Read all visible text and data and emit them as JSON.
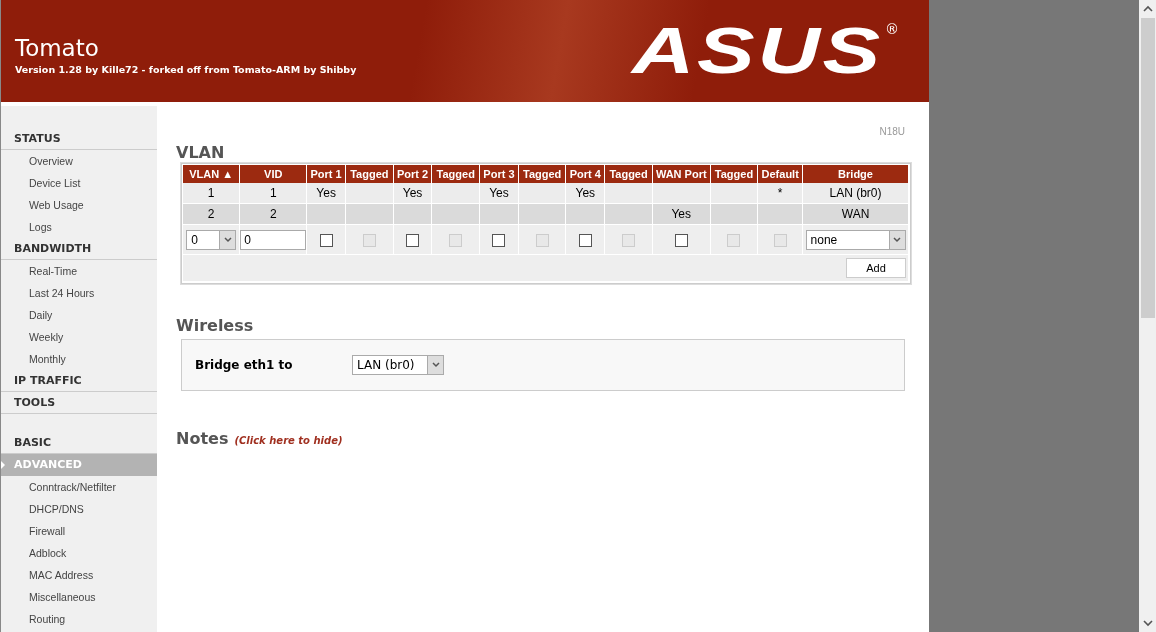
{
  "header": {
    "title": "Tomato",
    "subtitle": "Version 1.28 by Kille72 - forked off from Tomato-ARM by Shibby",
    "logo": "ASUS",
    "logo_mark": "®"
  },
  "sidebar": {
    "groups": [
      [
        {
          "label": "STATUS",
          "selected": false,
          "children": [
            {
              "label": "Overview"
            },
            {
              "label": "Device List"
            },
            {
              "label": "Web Usage"
            },
            {
              "label": "Logs"
            }
          ]
        },
        {
          "label": "BANDWIDTH",
          "selected": false,
          "children": [
            {
              "label": "Real-Time"
            },
            {
              "label": "Last 24 Hours"
            },
            {
              "label": "Daily"
            },
            {
              "label": "Weekly"
            },
            {
              "label": "Monthly"
            }
          ]
        },
        {
          "label": "IP TRAFFIC",
          "selected": false
        },
        {
          "label": "TOOLS",
          "selected": false
        }
      ],
      [
        {
          "label": "BASIC",
          "selected": false
        },
        {
          "label": "ADVANCED",
          "selected": true,
          "children": [
            {
              "label": "Conntrack/Netfilter"
            },
            {
              "label": "DHCP/DNS"
            },
            {
              "label": "Firewall"
            },
            {
              "label": "Adblock"
            },
            {
              "label": "MAC Address"
            },
            {
              "label": "Miscellaneous"
            },
            {
              "label": "Routing"
            }
          ]
        }
      ]
    ]
  },
  "model": "N18U",
  "vlan": {
    "title": "VLAN",
    "columns": [
      "VLAN ▲",
      "VID",
      "Port 1",
      "Tagged",
      "Port 2",
      "Tagged",
      "Port 3",
      "Tagged",
      "Port 4",
      "Tagged",
      "WAN Port",
      "Tagged",
      "Default",
      "Bridge"
    ],
    "rows": [
      [
        "1",
        "1",
        "Yes",
        "",
        "Yes",
        "",
        "Yes",
        "",
        "Yes",
        "",
        "",
        "",
        "*",
        "LAN (br0)"
      ],
      [
        "2",
        "2",
        "",
        "",
        "",
        "",
        "",
        "",
        "",
        "",
        "Yes",
        "",
        "",
        "WAN"
      ]
    ],
    "new_row": [
      {
        "kind": "select",
        "value": "0"
      },
      {
        "kind": "input",
        "value": "0"
      },
      {
        "kind": "checkbox",
        "checked": false,
        "disabled": false
      },
      {
        "kind": "checkbox",
        "checked": false,
        "disabled": true
      },
      {
        "kind": "checkbox",
        "checked": false,
        "disabled": false
      },
      {
        "kind": "checkbox",
        "checked": false,
        "disabled": true
      },
      {
        "kind": "checkbox",
        "checked": false,
        "disabled": false
      },
      {
        "kind": "checkbox",
        "checked": false,
        "disabled": true
      },
      {
        "kind": "checkbox",
        "checked": false,
        "disabled": false
      },
      {
        "kind": "checkbox",
        "checked": false,
        "disabled": true
      },
      {
        "kind": "checkbox",
        "checked": false,
        "disabled": false
      },
      {
        "kind": "checkbox",
        "checked": false,
        "disabled": true
      },
      {
        "kind": "checkbox",
        "checked": false,
        "disabled": true
      },
      {
        "kind": "select",
        "value": "none"
      }
    ],
    "add_button": "Add"
  },
  "wireless": {
    "title": "Wireless",
    "label": "Bridge eth1 to",
    "value": "LAN (br0)"
  },
  "notes": {
    "title": "Notes",
    "link": "(Click here to hide)"
  }
}
